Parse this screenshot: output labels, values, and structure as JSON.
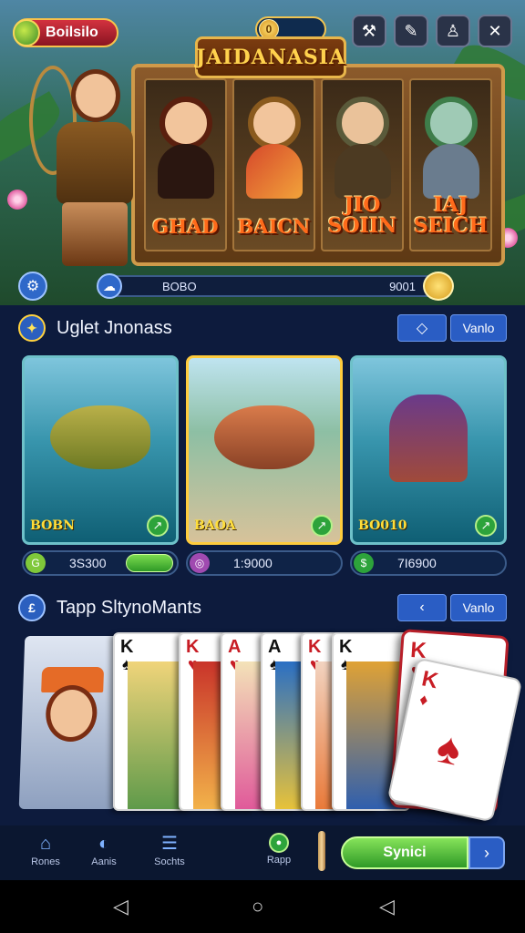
{
  "header": {
    "badge_label": "Boilsilo",
    "coin_value": "",
    "title": "JAIDANASIA",
    "top_icons": [
      "pickaxe-icon",
      "hammer-icon",
      "person-icon",
      "close-x-icon"
    ],
    "reel_labels": [
      "GHAD",
      "BAICN",
      "JIO SOIIN",
      "IAJ SEICH"
    ],
    "status_left": "BOBO",
    "status_right": "9001"
  },
  "section1": {
    "title": "Uglet Jnonass",
    "more_label": "Vanlo",
    "cards": [
      {
        "tag": "BOBN",
        "stat": "3S300"
      },
      {
        "tag": "BAOA",
        "stat": "1:9000"
      },
      {
        "tag": "BO010",
        "stat": "7I6900"
      }
    ]
  },
  "section2": {
    "title": "Tapp SltynoMants",
    "more_label": "Vanlo",
    "cards": [
      {
        "rank": "K",
        "suit": "♠",
        "color": "#111"
      },
      {
        "rank": "K",
        "suit": "♥",
        "color": "#c81d25"
      },
      {
        "rank": "A",
        "suit": "♥",
        "color": "#c81d25"
      },
      {
        "rank": "A",
        "suit": "♠",
        "color": "#111"
      },
      {
        "rank": "K",
        "suit": "♥",
        "color": "#c81d25"
      },
      {
        "rank": "K",
        "suit": "♠",
        "color": "#111"
      }
    ]
  },
  "bottom_nav": {
    "items": [
      "Rones",
      "Aanis",
      "Sochts",
      "Rapp"
    ],
    "cta_label": "Synici"
  },
  "colors": {
    "background": "#0d1b3d",
    "accent_blue": "#2a5dc4",
    "accent_green": "#2da33b",
    "gold": "#f7c24b"
  }
}
